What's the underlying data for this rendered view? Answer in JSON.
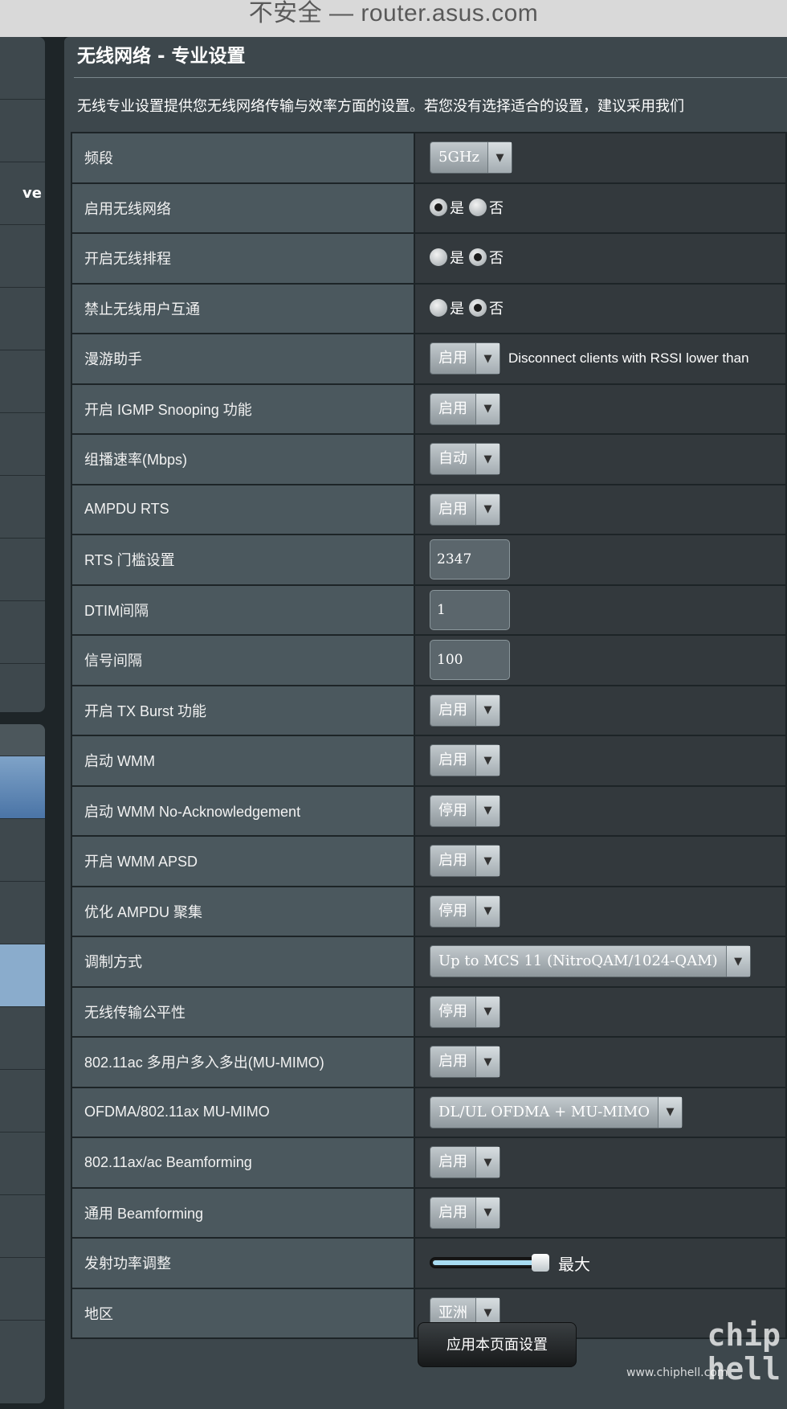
{
  "browser": {
    "url_text": "不安全 — router.asus.com"
  },
  "left_nav": {
    "fragment": "ve"
  },
  "page": {
    "title": "无线网络 - 专业设置",
    "description": "无线专业设置提供您无线网络传输与效率方面的设置。若您没有选择适合的设置，建议采用我们"
  },
  "settings": [
    {
      "label": "频段",
      "type": "select",
      "value": "5GHz"
    },
    {
      "label": "启用无线网络",
      "type": "radio",
      "options": [
        "是",
        "否"
      ],
      "selected": 0
    },
    {
      "label": "开启无线排程",
      "type": "radio",
      "options": [
        "是",
        "否"
      ],
      "selected": 1
    },
    {
      "label": "禁止无线用户互通",
      "type": "radio",
      "options": [
        "是",
        "否"
      ],
      "selected": 1
    },
    {
      "label": "漫游助手",
      "type": "select",
      "value": "启用",
      "extra": "Disconnect clients with RSSI lower than"
    },
    {
      "label": "开启 IGMP Snooping 功能",
      "type": "select",
      "value": "启用"
    },
    {
      "label": "组播速率(Mbps)",
      "type": "select",
      "value": "自动"
    },
    {
      "label": "AMPDU RTS",
      "type": "select",
      "value": "启用"
    },
    {
      "label": "RTS 门槛设置",
      "type": "text",
      "value": "2347"
    },
    {
      "label": "DTIM间隔",
      "type": "text",
      "value": "1"
    },
    {
      "label": "信号间隔",
      "type": "text",
      "value": "100"
    },
    {
      "label": "开启 TX Burst 功能",
      "type": "select",
      "value": "启用"
    },
    {
      "label": "启动 WMM",
      "type": "select",
      "value": "启用"
    },
    {
      "label": "启动 WMM No-Acknowledgement",
      "type": "select",
      "value": "停用"
    },
    {
      "label": "开启 WMM APSD",
      "type": "select",
      "value": "启用"
    },
    {
      "label": "优化 AMPDU 聚集",
      "type": "select",
      "value": "停用"
    },
    {
      "label": "调制方式",
      "type": "select",
      "value": "Up to MCS 11 (NitroQAM/1024-QAM)"
    },
    {
      "label": "无线传输公平性",
      "type": "select",
      "value": "停用"
    },
    {
      "label": "802.11ac 多用户多入多出(MU-MIMO)",
      "type": "select",
      "value": "启用"
    },
    {
      "label": "OFDMA/802.11ax MU-MIMO",
      "type": "select",
      "value": "DL/UL OFDMA + MU-MIMO"
    },
    {
      "label": "802.11ax/ac Beamforming",
      "type": "select",
      "value": "启用"
    },
    {
      "label": "通用 Beamforming",
      "type": "select",
      "value": "启用"
    },
    {
      "label": "发射功率调整",
      "type": "slider",
      "level": 1.0,
      "value_label": "最大"
    },
    {
      "label": "地区",
      "type": "select",
      "value": "亚洲"
    }
  ],
  "apply_button": {
    "label": "应用本页面设置"
  },
  "watermark": {
    "logo": "chip hell",
    "site": "www.chiphell.com"
  }
}
